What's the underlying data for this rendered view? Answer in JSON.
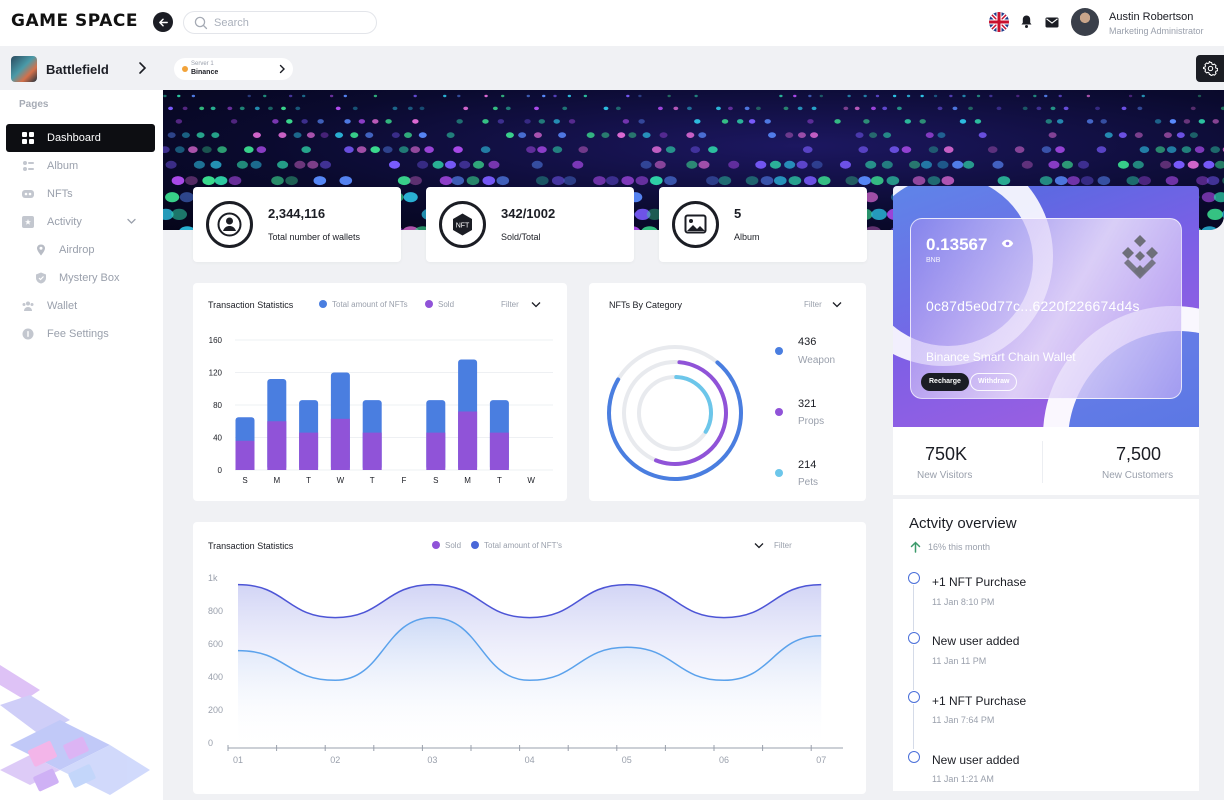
{
  "app": {
    "logo": "GAME SPACE"
  },
  "search": {
    "placeholder": "Search"
  },
  "user": {
    "name": "Austin Robertson",
    "role": "Marketing Administrator"
  },
  "game": {
    "name": "Battlefield"
  },
  "server": {
    "label": "Server 1",
    "value": "Binance"
  },
  "sidebar": {
    "section_title": "Pages",
    "items": [
      {
        "label": "Dashboard",
        "icon": "dashboard-icon",
        "active": true
      },
      {
        "label": "Album",
        "icon": "album-icon"
      },
      {
        "label": "NFTs",
        "icon": "nft-icon"
      },
      {
        "label": "Activity",
        "icon": "activity-icon"
      },
      {
        "label": "Airdrop",
        "icon": "airdrop-icon"
      },
      {
        "label": "Mystery Box",
        "icon": "mystery-box-icon"
      },
      {
        "label": "Wallet",
        "icon": "wallet-icon"
      },
      {
        "label": "Fee Settings",
        "icon": "fee-settings-icon"
      }
    ]
  },
  "stats": [
    {
      "value": "2,344,116",
      "label": "Total number of wallets",
      "icon": "user-icon"
    },
    {
      "value": "342/1002",
      "label": "Sold/Total",
      "icon": "nft-badge-icon",
      "icon_text": "NFT"
    },
    {
      "value": "5",
      "label": "Album",
      "icon": "image-icon"
    }
  ],
  "colors": {
    "blue": "#4a7ee0",
    "purple": "#9053d8",
    "cyan": "#6cc6ea",
    "dark": "#1b1d24"
  },
  "bar_chart": {
    "title": "Transaction Statistics",
    "legend_total": "Total amount of NFTs",
    "legend_sold": "Sold",
    "filter": "Filter"
  },
  "category_chart": {
    "title": "NFTs By Category",
    "filter": "Filter",
    "items": [
      {
        "value": "436",
        "label": "Weapon"
      },
      {
        "value": "321",
        "label": "Props"
      },
      {
        "value": "214",
        "label": "Pets"
      }
    ]
  },
  "line_chart": {
    "title": "Transaction Statistics",
    "legend_sold": "Sold",
    "legend_total": "Total amount of NFT's",
    "filter": "Filter"
  },
  "chart_data": [
    {
      "type": "bar",
      "title": "Transaction Statistics",
      "categories": [
        "S",
        "M",
        "T",
        "W",
        "T",
        "F",
        "S",
        "M",
        "T",
        "W"
      ],
      "series": [
        {
          "name": "Total amount of NFTs",
          "values": [
            65,
            112,
            86,
            120,
            86,
            null,
            86,
            136,
            86,
            null
          ]
        },
        {
          "name": "Sold",
          "values": [
            36,
            60,
            46,
            63,
            46,
            null,
            46,
            72,
            46,
            null
          ]
        }
      ],
      "y_ticks": [
        "160",
        "120",
        "80",
        "40",
        "0"
      ],
      "ylim": [
        0,
        160
      ],
      "stacked": false
    },
    {
      "type": "line",
      "title": "Transaction Statistics",
      "x": [
        "01",
        "02",
        "03",
        "04",
        "05",
        "06",
        "07"
      ],
      "series": [
        {
          "name": "Total amount of NFT's",
          "values": [
            960,
            760,
            960,
            760,
            960,
            760,
            960
          ]
        },
        {
          "name": "Sold",
          "values": [
            560,
            380,
            760,
            380,
            580,
            380,
            650
          ]
        }
      ],
      "y_ticks": [
        "1k",
        "800",
        "600",
        "400",
        "200",
        "0"
      ],
      "ylim": [
        0,
        1000
      ]
    }
  ],
  "wallet": {
    "balance": "0.13567",
    "currency": "BNB",
    "address": "0c87d5e0d77c...6220f226674d4s",
    "name": "Binance Smart Chain Wallet",
    "recharge": "Recharge",
    "withdraw": "Withdraw"
  },
  "visitors": {
    "value": "750K",
    "label": "New Visitors"
  },
  "customers": {
    "value": "7,500",
    "label": "New Customers"
  },
  "activity": {
    "title": "Actvity overview",
    "growth": "16% this month",
    "items": [
      {
        "title": "+1 NFT Purchase",
        "time": "11 Jan 8:10 PM"
      },
      {
        "title": "New user added",
        "time": "11 Jan 11 PM"
      },
      {
        "title": "+1 NFT Purchase",
        "time": "11 Jan 7:64 PM"
      },
      {
        "title": "New user added",
        "time": "11 Jan 1:21 AM"
      }
    ]
  }
}
